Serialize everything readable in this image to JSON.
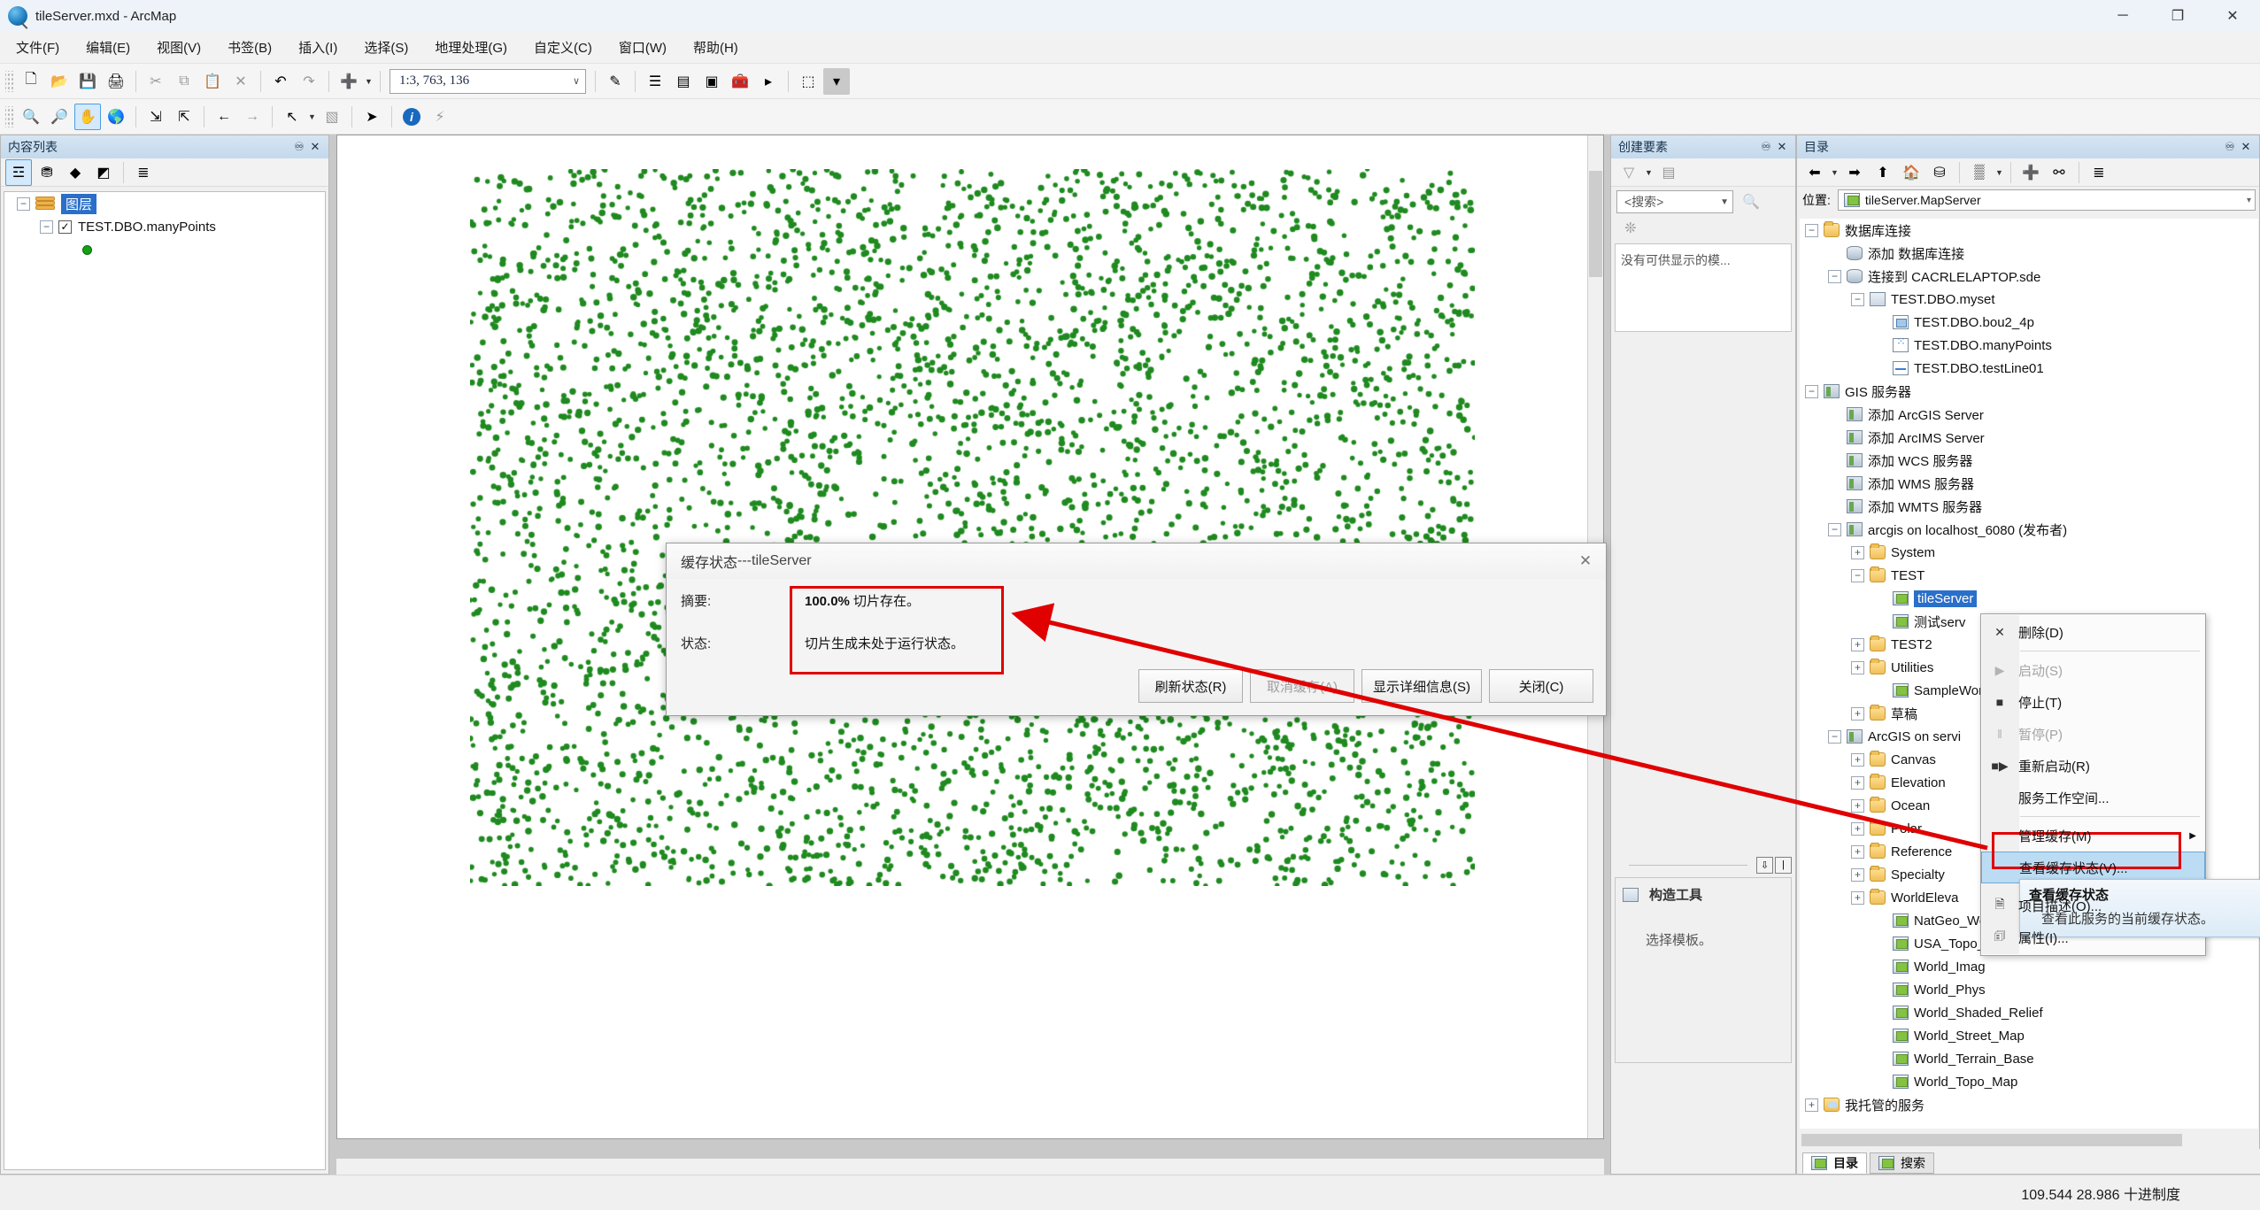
{
  "window": {
    "title": "tileServer.mxd - ArcMap",
    "app_icon": "arcmap-icon",
    "minimize": "─",
    "maximize": "❐",
    "close": "✕"
  },
  "menubar": {
    "items": [
      {
        "label": "文件(F)",
        "name": "menu-file"
      },
      {
        "label": "编辑(E)",
        "name": "menu-edit"
      },
      {
        "label": "视图(V)",
        "name": "menu-view"
      },
      {
        "label": "书签(B)",
        "name": "menu-bookmarks"
      },
      {
        "label": "插入(I)",
        "name": "menu-insert"
      },
      {
        "label": "选择(S)",
        "name": "menu-selection"
      },
      {
        "label": "地理处理(G)",
        "name": "menu-geoprocessing"
      },
      {
        "label": "自定义(C)",
        "name": "menu-customize"
      },
      {
        "label": "窗口(W)",
        "name": "menu-windows"
      },
      {
        "label": "帮助(H)",
        "name": "menu-help"
      }
    ]
  },
  "toolbar_standard": {
    "scale_value": "1:3, 763, 136",
    "buttons": [
      {
        "name": "new-document-icon",
        "glyph": "🗋",
        "state": "enabled"
      },
      {
        "name": "open-folder-icon",
        "glyph": "📂",
        "state": "enabled"
      },
      {
        "name": "save-icon",
        "glyph": "💾",
        "state": "enabled"
      },
      {
        "name": "print-icon",
        "glyph": "🖨",
        "state": "enabled"
      },
      {
        "name": "cut-icon",
        "glyph": "✂",
        "state": "disabled"
      },
      {
        "name": "copy-icon",
        "glyph": "⧉",
        "state": "disabled"
      },
      {
        "name": "paste-icon",
        "glyph": "📋",
        "state": "enabled"
      },
      {
        "name": "delete-icon",
        "glyph": "✕",
        "state": "disabled"
      },
      {
        "name": "undo-icon",
        "glyph": "↶",
        "state": "enabled"
      },
      {
        "name": "redo-icon",
        "glyph": "↷",
        "state": "disabled"
      },
      {
        "name": "add-data-icon",
        "glyph": "➕",
        "state": "enabled"
      },
      {
        "name": "editor-toolbar-icon",
        "glyph": "✎",
        "state": "enabled"
      },
      {
        "name": "table-of-contents-icon",
        "glyph": "☰",
        "state": "enabled"
      },
      {
        "name": "catalog-window-icon",
        "glyph": "▤",
        "state": "enabled"
      },
      {
        "name": "search-window-icon",
        "glyph": "▣",
        "state": "enabled"
      },
      {
        "name": "toolbox-window-icon",
        "glyph": "🧰",
        "state": "enabled"
      },
      {
        "name": "python-window-icon",
        "glyph": "▸",
        "state": "enabled"
      },
      {
        "name": "modelbuilder-icon",
        "glyph": "⬚",
        "state": "enabled"
      }
    ]
  },
  "toolbar_tools": {
    "buttons": [
      {
        "name": "zoom-in-icon",
        "glyph": "🔍",
        "state": "enabled"
      },
      {
        "name": "zoom-out-icon",
        "glyph": "🔎",
        "state": "enabled"
      },
      {
        "name": "pan-icon",
        "glyph": "✋",
        "state": "active"
      },
      {
        "name": "full-extent-icon",
        "glyph": "🌎",
        "state": "enabled"
      },
      {
        "name": "fixed-zoom-in-icon",
        "glyph": "⇲",
        "state": "enabled"
      },
      {
        "name": "fixed-zoom-out-icon",
        "glyph": "⇱",
        "state": "enabled"
      },
      {
        "name": "go-back-extent-icon",
        "glyph": "←",
        "state": "enabled"
      },
      {
        "name": "go-forward-extent-icon",
        "glyph": "→",
        "state": "disabled"
      },
      {
        "name": "select-features-icon",
        "glyph": "↖",
        "state": "enabled"
      },
      {
        "name": "clear-selection-icon",
        "glyph": "▧",
        "state": "disabled"
      },
      {
        "name": "select-elements-icon",
        "glyph": "➤",
        "state": "enabled"
      },
      {
        "name": "identify-icon",
        "glyph": "i",
        "state": "enabled"
      },
      {
        "name": "hyperlink-icon",
        "glyph": "⚡",
        "state": "disabled"
      }
    ]
  },
  "toc": {
    "title": "内容列表",
    "pin_icon": "pin-icon",
    "close_icon": "close-icon",
    "toolbar_buttons": [
      {
        "name": "list-by-drawing-order-icon",
        "glyph": "☲",
        "state": "active"
      },
      {
        "name": "list-by-source-icon",
        "glyph": "⛃",
        "state": "enabled"
      },
      {
        "name": "list-by-visibility-icon",
        "glyph": "◆",
        "state": "enabled"
      },
      {
        "name": "list-by-selection-icon",
        "glyph": "◩",
        "state": "enabled"
      },
      {
        "name": "options-icon",
        "glyph": "≣",
        "state": "enabled"
      }
    ],
    "tree": {
      "root_label": "图层",
      "layer_label": "TEST.DBO.manyPoints",
      "layer_checked": true,
      "symbol": "green-point-symbol"
    }
  },
  "map": {
    "points_count": 4200,
    "point_color": "#1f8a1f",
    "background": "#ffffff",
    "status_buttons": [
      {
        "name": "data-view-icon",
        "glyph": "▣",
        "state": "active"
      },
      {
        "name": "layout-view-icon",
        "glyph": "▤",
        "state": "enabled"
      },
      {
        "name": "refresh-view-icon",
        "glyph": "⟳",
        "state": "enabled"
      },
      {
        "name": "pause-drawing-icon",
        "glyph": "▐▐",
        "state": "enabled"
      }
    ]
  },
  "create_features": {
    "title": "创建要素",
    "pin_icon": "pin-icon",
    "close_icon": "close-icon",
    "search_value": "<搜索>",
    "empty_message": "没有可供显示的模...",
    "toolbar_buttons": [
      {
        "name": "filter-templates-icon",
        "glyph": "▽",
        "state": "disabled"
      },
      {
        "name": "organize-templates-icon",
        "glyph": "▤",
        "state": "disabled"
      },
      {
        "name": "create-new-template-icon",
        "glyph": "✲",
        "state": "disabled"
      }
    ],
    "construction_tools": {
      "title": "构造工具",
      "icon": "construction-tools-icon",
      "message": "选择模板。"
    }
  },
  "catalog": {
    "title": "目录",
    "pin_icon": "pin-icon",
    "close_icon": "close-icon",
    "toolbar_buttons": [
      {
        "name": "back-icon",
        "glyph": "⬅",
        "state": "enabled"
      },
      {
        "name": "back-dropdown-icon",
        "glyph": "▾",
        "state": "enabled"
      },
      {
        "name": "forward-icon",
        "glyph": "➡",
        "state": "enabled"
      },
      {
        "name": "up-one-level-icon",
        "glyph": "⬆",
        "state": "enabled"
      },
      {
        "name": "home-icon",
        "glyph": "🏠",
        "state": "enabled"
      },
      {
        "name": "default-geodatabase-icon",
        "glyph": "⛁",
        "state": "enabled"
      },
      {
        "name": "toggle-contents-panel-icon",
        "glyph": "▒",
        "state": "enabled"
      },
      {
        "name": "toggle-contents-dropdown-icon",
        "glyph": "▾",
        "state": "enabled"
      },
      {
        "name": "connect-to-folder-icon",
        "glyph": "➕",
        "state": "enabled"
      },
      {
        "name": "toggle-tree-icon",
        "glyph": "⚯",
        "state": "enabled"
      },
      {
        "name": "item-description-icon",
        "glyph": "≣",
        "state": "enabled"
      }
    ],
    "location_label": "位置:",
    "location_value": "tileServer.MapServer",
    "location_icon": "map-service-icon",
    "tree": [
      {
        "label": "数据库连接",
        "indent": 0,
        "expander": "-",
        "icon": "folder-connection-icon",
        "icon_class": "folder"
      },
      {
        "label": "添加 数据库连接",
        "indent": 1,
        "expander": "",
        "icon": "add-database-connection-icon",
        "icon_class": "db"
      },
      {
        "label": "连接到 CACRLELAPTOP.sde",
        "indent": 1,
        "expander": "-",
        "icon": "database-connection-icon",
        "icon_class": "db"
      },
      {
        "label": "TEST.DBO.myset",
        "indent": 2,
        "expander": "-",
        "icon": "feature-dataset-icon",
        "icon_class": "dataset"
      },
      {
        "label": "TEST.DBO.bou2_4p",
        "indent": 3,
        "expander": "",
        "icon": "polygon-feature-class-icon",
        "icon_class": "fc-poly"
      },
      {
        "label": "TEST.DBO.manyPoints",
        "indent": 3,
        "expander": "",
        "icon": "point-feature-class-icon",
        "icon_class": "fc-point"
      },
      {
        "label": "TEST.DBO.testLine01",
        "indent": 3,
        "expander": "",
        "icon": "line-feature-class-icon",
        "icon_class": "fc-line"
      },
      {
        "label": "GIS 服务器",
        "indent": 0,
        "expander": "-",
        "icon": "gis-servers-icon",
        "icon_class": "server"
      },
      {
        "label": "添加 ArcGIS Server",
        "indent": 1,
        "expander": "",
        "icon": "add-arcgis-server-icon",
        "icon_class": "server"
      },
      {
        "label": "添加 ArcIMS Server",
        "indent": 1,
        "expander": "",
        "icon": "add-arcims-server-icon",
        "icon_class": "server"
      },
      {
        "label": "添加 WCS 服务器",
        "indent": 1,
        "expander": "",
        "icon": "add-wcs-server-icon",
        "icon_class": "server"
      },
      {
        "label": "添加 WMS 服务器",
        "indent": 1,
        "expander": "",
        "icon": "add-wms-server-icon",
        "icon_class": "server"
      },
      {
        "label": "添加 WMTS 服务器",
        "indent": 1,
        "expander": "",
        "icon": "add-wmts-server-icon",
        "icon_class": "server"
      },
      {
        "label": "arcgis on localhost_6080 (发布者)",
        "indent": 1,
        "expander": "-",
        "icon": "arcgis-server-connection-icon",
        "icon_class": "server"
      },
      {
        "label": "System",
        "indent": 2,
        "expander": "+",
        "icon": "folder-icon",
        "icon_class": "folder"
      },
      {
        "label": "TEST",
        "indent": 2,
        "expander": "-",
        "icon": "folder-icon",
        "icon_class": "folder"
      },
      {
        "label": "tileServer",
        "indent": 3,
        "expander": "",
        "icon": "map-service-icon",
        "icon_class": "mapsvc",
        "selected": true
      },
      {
        "label": "测试serv",
        "indent": 3,
        "expander": "",
        "icon": "map-service-icon",
        "icon_class": "mapsvc"
      },
      {
        "label": "TEST2",
        "indent": 2,
        "expander": "+",
        "icon": "folder-icon",
        "icon_class": "folder"
      },
      {
        "label": "Utilities",
        "indent": 2,
        "expander": "+",
        "icon": "folder-icon",
        "icon_class": "folder"
      },
      {
        "label": "SampleWor",
        "indent": 3,
        "expander": "",
        "icon": "map-service-icon",
        "icon_class": "mapsvc"
      },
      {
        "label": "草稿",
        "indent": 2,
        "expander": "+",
        "icon": "draft-folder-icon",
        "icon_class": "folder"
      },
      {
        "label": "ArcGIS on servi",
        "indent": 1,
        "expander": "-",
        "icon": "arcgis-server-connection-icon",
        "icon_class": "server"
      },
      {
        "label": "Canvas",
        "indent": 2,
        "expander": "+",
        "icon": "folder-icon",
        "icon_class": "folder"
      },
      {
        "label": "Elevation",
        "indent": 2,
        "expander": "+",
        "icon": "folder-icon",
        "icon_class": "folder"
      },
      {
        "label": "Ocean",
        "indent": 2,
        "expander": "+",
        "icon": "folder-icon",
        "icon_class": "folder"
      },
      {
        "label": "Polar",
        "indent": 2,
        "expander": "+",
        "icon": "folder-icon",
        "icon_class": "folder"
      },
      {
        "label": "Reference",
        "indent": 2,
        "expander": "+",
        "icon": "folder-icon",
        "icon_class": "folder"
      },
      {
        "label": "Specialty",
        "indent": 2,
        "expander": "+",
        "icon": "folder-icon",
        "icon_class": "folder"
      },
      {
        "label": "WorldEleva",
        "indent": 2,
        "expander": "+",
        "icon": "folder-icon",
        "icon_class": "folder"
      },
      {
        "label": "NatGeo_Wo",
        "indent": 3,
        "expander": "",
        "icon": "map-service-icon",
        "icon_class": "mapsvc"
      },
      {
        "label": "USA_Topo_",
        "indent": 3,
        "expander": "",
        "icon": "map-service-icon",
        "icon_class": "mapsvc"
      },
      {
        "label": "World_Imag",
        "indent": 3,
        "expander": "",
        "icon": "map-service-icon",
        "icon_class": "mapsvc"
      },
      {
        "label": "World_Phys",
        "indent": 3,
        "expander": "",
        "icon": "map-service-icon",
        "icon_class": "mapsvc"
      },
      {
        "label": "World_Shaded_Relief",
        "indent": 3,
        "expander": "",
        "icon": "map-service-icon",
        "icon_class": "mapsvc"
      },
      {
        "label": "World_Street_Map",
        "indent": 3,
        "expander": "",
        "icon": "map-service-icon",
        "icon_class": "mapsvc"
      },
      {
        "label": "World_Terrain_Base",
        "indent": 3,
        "expander": "",
        "icon": "map-service-icon",
        "icon_class": "mapsvc"
      },
      {
        "label": "World_Topo_Map",
        "indent": 3,
        "expander": "",
        "icon": "map-service-icon",
        "icon_class": "mapsvc"
      },
      {
        "label": "我托管的服务",
        "indent": 0,
        "expander": "+",
        "icon": "my-hosted-services-icon",
        "icon_class": "cloud"
      }
    ],
    "tabs": [
      {
        "label": "目录",
        "name": "tab-catalog",
        "icon": "catalog-icon",
        "active": true
      },
      {
        "label": "搜索",
        "name": "tab-search",
        "icon": "search-icon",
        "active": false
      }
    ]
  },
  "context_menu": {
    "items": [
      {
        "label": "删除(D)",
        "icon": "delete-icon",
        "glyph": "✕",
        "state": "enabled",
        "submenu": false
      },
      {
        "sep": true
      },
      {
        "label": "启动(S)",
        "icon": "start-icon",
        "glyph": "▶",
        "state": "disabled",
        "submenu": false
      },
      {
        "label": "停止(T)",
        "icon": "stop-icon",
        "glyph": "■",
        "state": "enabled",
        "submenu": false
      },
      {
        "label": "暂停(P)",
        "icon": "pause-icon",
        "glyph": "‖",
        "state": "disabled",
        "submenu": false
      },
      {
        "label": "重新启动(R)",
        "icon": "restart-icon",
        "glyph": "■▶",
        "state": "enabled",
        "submenu": false
      },
      {
        "label": "服务工作空间...",
        "icon": "service-workspace-icon",
        "glyph": "",
        "state": "enabled",
        "submenu": false
      },
      {
        "sep": true
      },
      {
        "label": "管理缓存(M)",
        "icon": "manage-cache-icon",
        "glyph": "",
        "state": "enabled",
        "submenu": true
      },
      {
        "label": "查看缓存状态(V)...",
        "icon": "view-cache-status-icon",
        "glyph": "",
        "state": "enabled",
        "submenu": false,
        "highlight": true
      },
      {
        "sep": true
      },
      {
        "label": "项目描述(O)...",
        "icon": "item-description-icon",
        "glyph": "🗎",
        "state": "enabled",
        "submenu": false
      },
      {
        "label": "属性(I)...",
        "icon": "properties-icon",
        "glyph": "🗊",
        "state": "enabled",
        "submenu": false
      }
    ],
    "tooltip": {
      "title": "查看缓存状态",
      "body": "查看此服务的当前缓存状态。"
    }
  },
  "cache_dialog": {
    "title_main": "缓存状态",
    "title_sep": " --- ",
    "title_service": "tileServer",
    "close_icon": "close-icon",
    "summary_label": "摘要:",
    "summary_percent": "100.0%",
    "summary_text": " 切片存在。",
    "status_label": "状态:",
    "status_text": "切片生成未处于运行状态。",
    "buttons": [
      {
        "label": "刷新状态(R)",
        "name": "refresh-status-button",
        "state": "enabled"
      },
      {
        "label": "取消缓存(A)",
        "name": "cancel-cache-button",
        "state": "disabled"
      },
      {
        "label": "显示详细信息(S)",
        "name": "show-details-button",
        "state": "enabled"
      },
      {
        "label": "关闭(C)",
        "name": "close-button",
        "state": "enabled"
      }
    ]
  },
  "statusbar": {
    "coordinates": "109.544  28.986 十进制度"
  },
  "annotations": {
    "arrow_color": "#e00000",
    "highlight_box_color": "#e00000"
  }
}
